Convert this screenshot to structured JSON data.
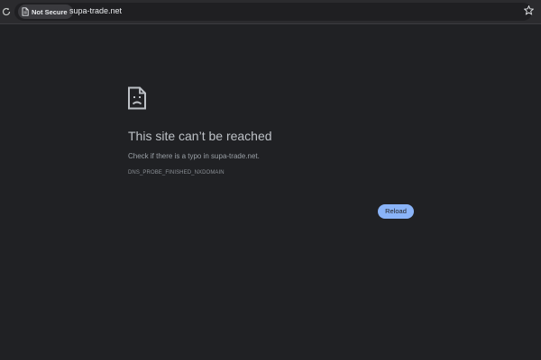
{
  "toolbar": {
    "reload_icon": "reload-icon",
    "security_chip": {
      "label": "Not Secure",
      "icon": "page-icon"
    },
    "url": "supa-trade.net",
    "bookmark_icon": "star-icon"
  },
  "error_page": {
    "icon": "sad-document-icon",
    "title": "This site can’t be reached",
    "message": "Check if there is a typo in supa-trade.net.",
    "error_code": "DNS_PROBE_FINISHED_NXDOMAIN",
    "reload_label": "Reload"
  },
  "colors": {
    "background": "#202124",
    "toolbar": "#2b2b2e",
    "accent_button": "#8ab4f8",
    "title_text": "#bdc1c6",
    "body_text": "#9aa0a6"
  }
}
